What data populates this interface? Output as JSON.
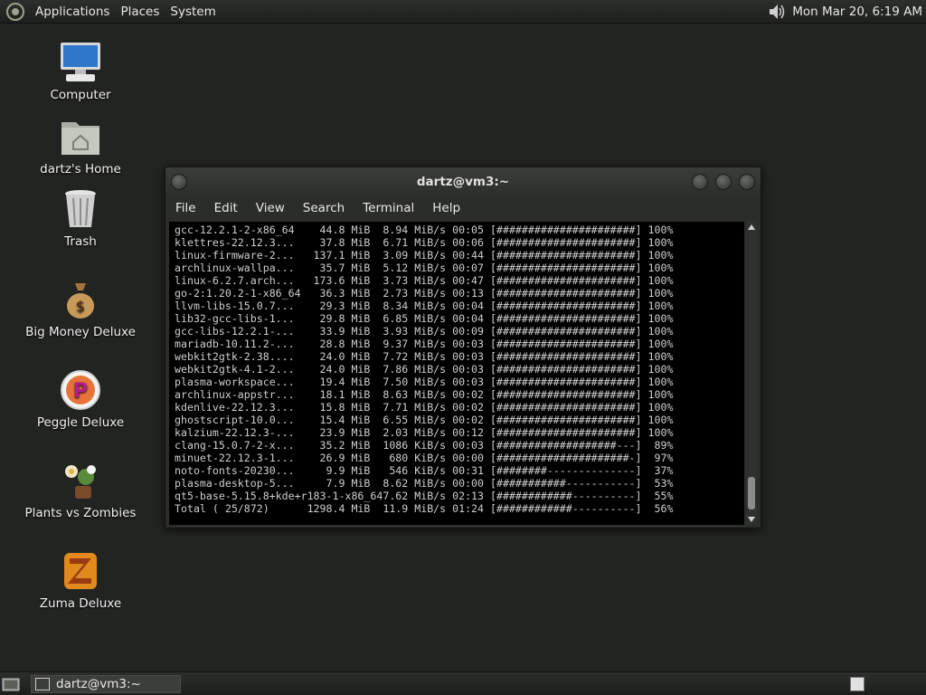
{
  "top_panel": {
    "menus": [
      "Applications",
      "Places",
      "System"
    ],
    "clock": "Mon Mar 20,  6:19 AM"
  },
  "desktop": {
    "icons": [
      {
        "label": "Computer",
        "icon": "computer-icon"
      },
      {
        "label": "dartz's Home",
        "icon": "home-folder-icon"
      },
      {
        "label": "Trash",
        "icon": "trash-icon"
      },
      {
        "label": "Big Money Deluxe",
        "icon": "money-bag-icon"
      },
      {
        "label": "Peggle Deluxe",
        "icon": "peggle-icon"
      },
      {
        "label": "Plants vs Zombies",
        "icon": "plants-icon"
      },
      {
        "label": "Zuma Deluxe",
        "icon": "zuma-icon"
      }
    ]
  },
  "terminal_window": {
    "title": "dartz@vm3:~",
    "menus": [
      "File",
      "Edit",
      "View",
      "Search",
      "Terminal",
      "Help"
    ],
    "lines": [
      "gcc-12.2.1-2-x86_64    44.8 MiB  8.94 MiB/s 00:05 [######################] 100%",
      "klettres-22.12.3...    37.8 MiB  6.71 MiB/s 00:06 [######################] 100%",
      "linux-firmware-2...   137.1 MiB  3.09 MiB/s 00:44 [######################] 100%",
      "archlinux-wallpa...    35.7 MiB  5.12 MiB/s 00:07 [######################] 100%",
      "linux-6.2.7.arch...   173.6 MiB  3.73 MiB/s 00:47 [######################] 100%",
      "go-2:1.20.2-1-x86_64   36.3 MiB  2.73 MiB/s 00:13 [######################] 100%",
      "llvm-libs-15.0.7...    29.3 MiB  8.34 MiB/s 00:04 [######################] 100%",
      "lib32-gcc-libs-1...    29.8 MiB  6.85 MiB/s 00:04 [######################] 100%",
      "gcc-libs-12.2.1-...    33.9 MiB  3.93 MiB/s 00:09 [######################] 100%",
      "mariadb-10.11.2-...    28.8 MiB  9.37 MiB/s 00:03 [######################] 100%",
      "webkit2gtk-2.38....    24.0 MiB  7.72 MiB/s 00:03 [######################] 100%",
      "webkit2gtk-4.1-2...    24.0 MiB  7.86 MiB/s 00:03 [######################] 100%",
      "plasma-workspace...    19.4 MiB  7.50 MiB/s 00:03 [######################] 100%",
      "archlinux-appstr...    18.1 MiB  8.63 MiB/s 00:02 [######################] 100%",
      "kdenlive-22.12.3...    15.8 MiB  7.71 MiB/s 00:02 [######################] 100%",
      "ghostscript-10.0...    15.4 MiB  6.55 MiB/s 00:02 [######################] 100%",
      "kalzium-22.12.3-...    23.9 MiB  2.03 MiB/s 00:12 [######################] 100%",
      "clang-15.0.7-2-x...    35.2 MiB  1086 KiB/s 00:03 [###################---]  89%",
      "minuet-22.12.3-1...    26.9 MiB   680 KiB/s 00:00 [#####################-]  97%",
      "noto-fonts-20230...     9.9 MiB   546 KiB/s 00:31 [########--------------]  37%",
      "plasma-desktop-5...     7.9 MiB  8.62 MiB/s 00:00 [###########-----------]  53%",
      "qt5-base-5.15.8+kde+r183-1-x86_647.62 MiB/s 02:13 [############----------]  55%",
      "Total ( 25/872)      1298.4 MiB  11.9 MiB/s 01:24 [############----------]  56%"
    ]
  },
  "bottom_panel": {
    "task_label": "dartz@vm3:~"
  }
}
